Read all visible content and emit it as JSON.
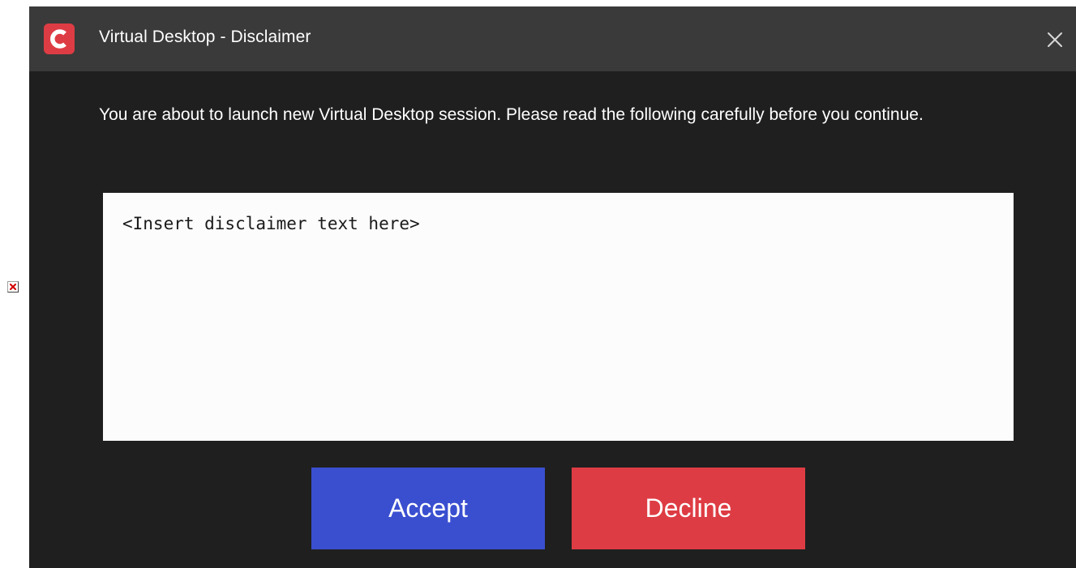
{
  "window": {
    "title": "Virtual Desktop - Disclaimer",
    "logo_icon": "comodo-c-logo-icon",
    "close_icon": "close-icon"
  },
  "content": {
    "intro_text": "You are about to launch new Virtual Desktop session. Please read the following carefully before you continue.",
    "disclaimer_text": "<Insert disclaimer text here>"
  },
  "buttons": {
    "accept_label": "Accept",
    "decline_label": "Decline"
  },
  "colors": {
    "titlebar": "#3a3a3a",
    "background": "#1f1f1f",
    "accent_red": "#de3c44",
    "accept_blue": "#3a4fd0"
  }
}
